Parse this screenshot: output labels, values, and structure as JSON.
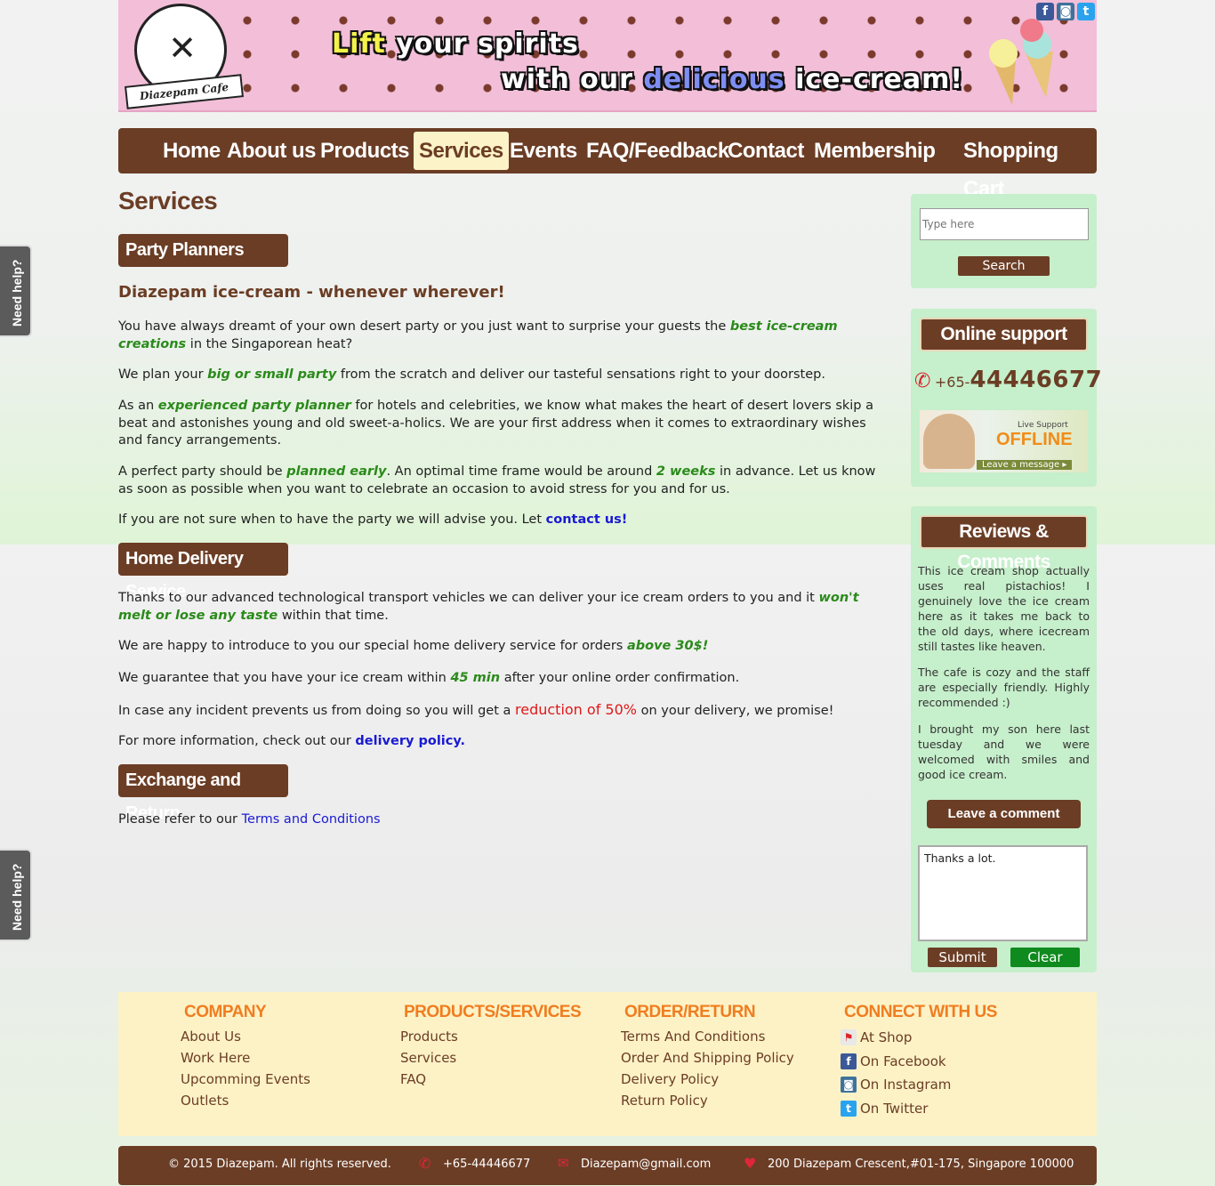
{
  "banner": {
    "logo_text": "Diazepam Cafe",
    "slogan_line1_hl": "Lift",
    "slogan_line1_rest": "your spirits",
    "slogan_line2_pre": "with our",
    "slogan_line2_hl": "delicious",
    "slogan_line2_post": "ice-cream!",
    "social": [
      "facebook-icon",
      "instagram-icon",
      "twitter-icon"
    ]
  },
  "nav": {
    "items": [
      "Home",
      "About us",
      "Products",
      "Services",
      "Events",
      "FAQ/Feedback",
      "Contact",
      "Membership",
      "Shopping Cart"
    ],
    "active": "Services"
  },
  "main": {
    "title": "Services",
    "party": {
      "heading": "Party Planners",
      "subheading": "Diazepam ice-cream - whenever wherever!",
      "p1_a": "You have always dreamt of your own desert party or you just want to surprise your guests the ",
      "p1_em": "best ice-cream creations",
      "p1_b": " in the Singaporean heat?",
      "p2_a": "We plan your ",
      "p2_em": "big or small party",
      "p2_b": " from the scratch and deliver our tasteful sensations right to your doorstep.",
      "p3_a": "As an ",
      "p3_em": "experienced party planner",
      "p3_b": " for hotels and celebrities, we know what makes the heart of desert lovers skip a beat and astonishes young and old sweet-a-holics. We are your first address when it comes to extraordinary wishes and fancy arrangements.",
      "p4_a": "A perfect party should be ",
      "p4_em1": "planned early",
      "p4_b": ". An optimal time frame would be around ",
      "p4_em2": "2 weeks",
      "p4_c": " in advance. Let us know as soon as possible when you want to celebrate an occasion to avoid stress for you and for us.",
      "p5_a": "If you are not sure when to have the party we will advise you. Let ",
      "p5_link": "contact us!"
    },
    "delivery": {
      "heading": "Home Delivery Service",
      "p1_a": "Thanks to our advanced technological transport vehicles we can deliver your ice cream orders to you and it ",
      "p1_em": "won't melt or lose any taste",
      "p1_b": " within that time.",
      "p2_a": "We are happy to introduce to you our special home delivery service for orders ",
      "p2_em": "above 30$!",
      "p3_a": "We guarantee that you have your ice cream within ",
      "p3_em": "45 min",
      "p3_b": " after your online order confirmation.",
      "p4_a": "In case any incident prevents us from doing so you will get a ",
      "p4_red": "reduction of 50%",
      "p4_b": " on your delivery, we promise!",
      "p5_a": "For more information, check out our ",
      "p5_link": "delivery policy."
    },
    "exchange": {
      "heading": "Exchange and Return",
      "p1_a": "Please refer to our ",
      "p1_link": "Terms and Conditions"
    }
  },
  "sidebar": {
    "search_placeholder": "Type here",
    "search_button": "Search",
    "support_title": "Online support",
    "phone_prefix": "+65-",
    "phone_number": "44446677",
    "support_live": "Live Support",
    "support_status": "OFFLINE",
    "support_leave": "Leave a message ▸",
    "reviews_title": "Reviews & Comments",
    "reviews": [
      "This ice cream shop actually uses real pistachios! I genuinely love the ice cream here as it takes me back to the old days, where icecream still tastes like heaven.",
      "The cafe is cozy and the staff are especially friendly. Highly recommended :)",
      "I brought my son here last tuesday and we were welcomed with smiles and good ice cream."
    ],
    "leave_comment": "Leave a comment",
    "comment_value": "Thanks a lot.",
    "submit": "Submit",
    "clear": "Clear"
  },
  "help_tab": "Need help?",
  "footer": {
    "company": {
      "title": "COMPANY",
      "links": [
        "About Us",
        "Work Here",
        "Upcomming Events",
        "Outlets"
      ]
    },
    "products": {
      "title": "PRODUCTS/SERVICES",
      "links": [
        "Products",
        "Services",
        "FAQ"
      ]
    },
    "order": {
      "title": "ORDER/RETURN",
      "links": [
        "Terms And Conditions",
        "Order And Shipping Policy",
        "Delivery Policy",
        "Return Policy"
      ]
    },
    "connect": {
      "title": "CONNECT WITH US",
      "links": [
        "At Shop",
        "On Facebook",
        "On Instagram",
        "On Twitter"
      ]
    }
  },
  "bottom": {
    "copyright": "© 2015 Diazepam. All rights reserved.",
    "phone": "+65-44446677",
    "email": "Diazepam@gmail.com",
    "address": "200 Diazepam Crescent,#01-175, Singapore 100000"
  },
  "colors": {
    "brown": "#6b3d25",
    "cream": "#fdf3c8",
    "green_box": "#c6efcb",
    "emphasis": "#2a8a1a",
    "link": "#1a1ad2",
    "accent_orange": "#f07d20"
  }
}
